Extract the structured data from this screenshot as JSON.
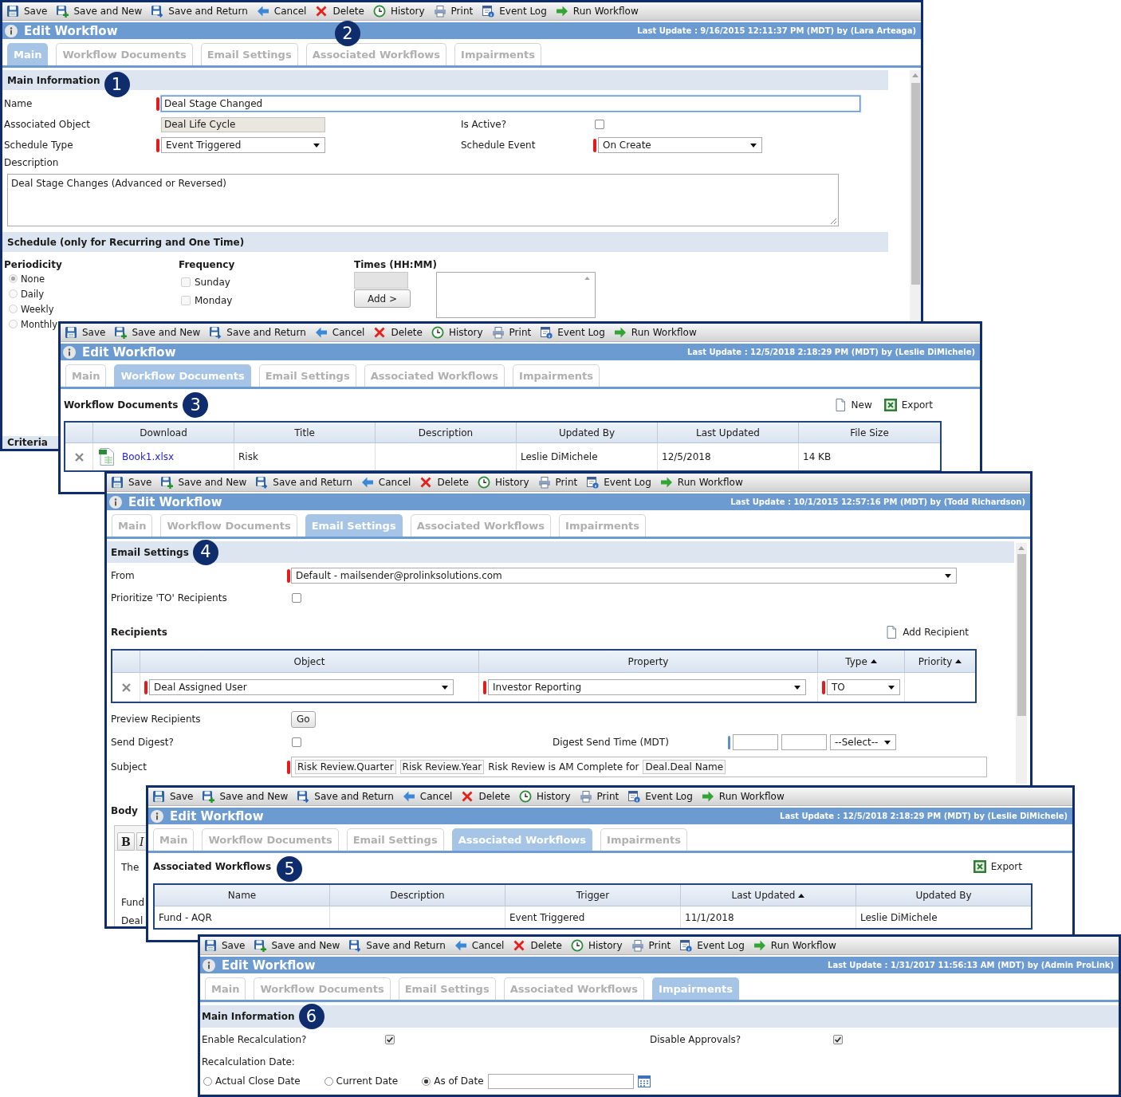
{
  "windows": [
    {
      "kind": "main",
      "toolbar": [
        {
          "kind": "save",
          "label": "Save"
        },
        {
          "kind": "save_new",
          "label": "Save and New"
        },
        {
          "kind": "save_return",
          "label": "Save and Return"
        },
        {
          "kind": "cancel",
          "label": "Cancel"
        },
        {
          "kind": "delete",
          "label": "Delete"
        },
        {
          "kind": "history",
          "label": "History"
        },
        {
          "kind": "print",
          "label": "Print"
        },
        {
          "kind": "event_log",
          "label": "Event Log"
        },
        {
          "kind": "run",
          "label": "Run Workflow"
        }
      ],
      "title": "Edit Workflow",
      "title_callout": "2",
      "last_update": "Last Update : 9/16/2015 12:11:37 PM (MDT) by (Lara Arteaga)",
      "tabs": [
        {
          "label": "Main",
          "selected": true
        },
        {
          "label": "Workflow Documents",
          "selected": false
        },
        {
          "label": "Email Settings",
          "selected": false
        },
        {
          "label": "Associated Workflows",
          "selected": false
        },
        {
          "label": "Impairments",
          "selected": false
        }
      ],
      "main_information": {
        "heading": "Main Information",
        "callout": "1",
        "name": {
          "label": "Name",
          "value": "Deal Stage Changed",
          "required": true,
          "focused": true
        },
        "associated_object": {
          "label": "Associated Object",
          "value": "Deal Life Cycle",
          "readonly": true
        },
        "is_active": {
          "label": "Is Active?",
          "checked": false
        },
        "schedule_type": {
          "label": "Schedule Type",
          "value": "Event Triggered",
          "required": true
        },
        "schedule_event": {
          "label": "Schedule Event",
          "value": "On Create",
          "required": true
        },
        "description": {
          "label": "Description",
          "value": "Deal Stage Changes (Advanced or Reversed)"
        }
      },
      "schedule": {
        "heading": "Schedule (only for Recurring and One Time)",
        "periodicity": {
          "label": "Periodicity",
          "options": [
            {
              "label": "None",
              "selected": true,
              "disabled": true
            },
            {
              "label": "Daily",
              "selected": false,
              "disabled": true
            },
            {
              "label": "Weekly",
              "selected": false,
              "disabled": true
            },
            {
              "label": "Monthly",
              "selected": false,
              "disabled": true
            }
          ]
        },
        "frequency": {
          "label": "Frequency",
          "options": [
            {
              "label": "Sunday",
              "checked": false,
              "disabled": true
            },
            {
              "label": "Monday",
              "checked": false,
              "disabled": true
            }
          ]
        },
        "times": {
          "label": "Times (HH:MM)",
          "disabled": true,
          "add_button": "Add >"
        }
      },
      "criteria": {
        "heading": "Criteria"
      }
    },
    {
      "kind": "documents",
      "toolbar": [
        {
          "kind": "save",
          "label": "Save"
        },
        {
          "kind": "save_new",
          "label": "Save and New"
        },
        {
          "kind": "save_return",
          "label": "Save and Return"
        },
        {
          "kind": "cancel",
          "label": "Cancel"
        },
        {
          "kind": "delete",
          "label": "Delete"
        },
        {
          "kind": "history",
          "label": "History"
        },
        {
          "kind": "print",
          "label": "Print"
        },
        {
          "kind": "event_log",
          "label": "Event Log"
        },
        {
          "kind": "run",
          "label": "Run Workflow"
        }
      ],
      "title": "Edit Workflow",
      "last_update": "Last Update : 12/5/2018 2:18:29 PM (MDT) by (Leslie DiMichele)",
      "tabs": [
        {
          "label": "Main",
          "selected": false
        },
        {
          "label": "Workflow Documents",
          "selected": true
        },
        {
          "label": "Email Settings",
          "selected": false
        },
        {
          "label": "Associated Workflows",
          "selected": false
        },
        {
          "label": "Impairments",
          "selected": false
        }
      ],
      "documents": {
        "heading": "Workflow Documents",
        "callout": "3",
        "actions": [
          {
            "kind": "new",
            "label": "New"
          },
          {
            "kind": "export",
            "label": "Export"
          }
        ],
        "columns": [
          {
            "label": "Download"
          },
          {
            "label": "Title"
          },
          {
            "label": "Description"
          },
          {
            "label": "Updated By"
          },
          {
            "label": "Last Updated"
          },
          {
            "label": "File Size"
          }
        ],
        "rows": [
          {
            "download": "Book1.xlsx",
            "title": "Risk",
            "updated_by": "Leslie DiMichele",
            "last_updated": "12/5/2018",
            "file_size": "14 KB"
          }
        ]
      }
    },
    {
      "kind": "email",
      "toolbar": [
        {
          "kind": "save",
          "label": "Save"
        },
        {
          "kind": "save_new",
          "label": "Save and New"
        },
        {
          "kind": "save_return",
          "label": "Save and Return"
        },
        {
          "kind": "cancel",
          "label": "Cancel"
        },
        {
          "kind": "delete",
          "label": "Delete"
        },
        {
          "kind": "history",
          "label": "History"
        },
        {
          "kind": "print",
          "label": "Print"
        },
        {
          "kind": "event_log",
          "label": "Event Log"
        },
        {
          "kind": "run",
          "label": "Run Workflow"
        }
      ],
      "title": "Edit Workflow",
      "last_update": "Last Update : 10/1/2015 12:57:16 PM (MDT) by (Todd Richardson)",
      "tabs": [
        {
          "label": "Main",
          "selected": false
        },
        {
          "label": "Workflow Documents",
          "selected": false
        },
        {
          "label": "Email Settings",
          "selected": true
        },
        {
          "label": "Associated Workflows",
          "selected": false
        },
        {
          "label": "Impairments",
          "selected": false
        }
      ],
      "email": {
        "heading": "Email Settings",
        "callout": "4",
        "from": {
          "label": "From",
          "value": "Default - mailsender@prolinksolutions.com",
          "required": true
        },
        "prioritize_to": {
          "label": "Prioritize 'TO' Recipients",
          "checked": false
        },
        "recipients": {
          "heading": "Recipients",
          "actions": [
            {
              "kind": "add",
              "label": "Add Recipient"
            }
          ],
          "columns": [
            {
              "label": "Object",
              "sorted": false
            },
            {
              "label": "Property",
              "sorted": false
            },
            {
              "label": "Type",
              "sorted": true
            },
            {
              "label": "Priority",
              "sorted": true
            }
          ],
          "rows": [
            {
              "object": {
                "value": "Deal Assigned User",
                "required": true
              },
              "property": {
                "value": "Investor Reporting",
                "required": true
              },
              "type": {
                "value": "TO",
                "required": true
              }
            }
          ]
        },
        "preview": {
          "label": "Preview Recipients",
          "button": "Go"
        },
        "send_digest": {
          "label": "Send Digest?",
          "checked": false
        },
        "digest_time": {
          "label": "Digest Send Time (MDT)",
          "marked": true,
          "select": "--Select--"
        },
        "subject": {
          "label": "Subject",
          "required": true,
          "parts": [
            {
              "kind": "token",
              "text": "Risk Review.Quarter"
            },
            {
              "kind": "token",
              "text": "Risk Review.Year"
            },
            {
              "kind": "text",
              "text": "Risk Review is AM Complete for"
            },
            {
              "kind": "token",
              "text": "Deal.Deal Name"
            }
          ]
        },
        "body": {
          "heading": "Body",
          "format_buttons": [
            {
              "kind": "bold",
              "label": "B"
            },
            {
              "kind": "italic",
              "label": "I"
            }
          ],
          "lines": [
            "The",
            "Fund",
            "Deal"
          ]
        }
      }
    },
    {
      "kind": "associated",
      "toolbar": [
        {
          "kind": "save",
          "label": "Save"
        },
        {
          "kind": "save_new",
          "label": "Save and New"
        },
        {
          "kind": "save_return",
          "label": "Save and Return"
        },
        {
          "kind": "cancel",
          "label": "Cancel"
        },
        {
          "kind": "delete",
          "label": "Delete"
        },
        {
          "kind": "history",
          "label": "History"
        },
        {
          "kind": "print",
          "label": "Print"
        },
        {
          "kind": "event_log",
          "label": "Event Log"
        },
        {
          "kind": "run",
          "label": "Run Workflow"
        }
      ],
      "title": "Edit Workflow",
      "last_update": "Last Update : 12/5/2018 2:18:29 PM (MDT) by (Leslie DiMichele)",
      "tabs": [
        {
          "label": "Main",
          "selected": false
        },
        {
          "label": "Workflow Documents",
          "selected": false
        },
        {
          "label": "Email Settings",
          "selected": false
        },
        {
          "label": "Associated Workflows",
          "selected": true
        },
        {
          "label": "Impairments",
          "selected": false
        }
      ],
      "associated": {
        "heading": "Associated Workflows",
        "callout": "5",
        "actions": [
          {
            "kind": "export",
            "label": "Export"
          }
        ],
        "columns": [
          {
            "label": "Name",
            "sorted": false
          },
          {
            "label": "Description",
            "sorted": false
          },
          {
            "label": "Trigger",
            "sorted": false
          },
          {
            "label": "Last Updated",
            "sorted": true
          },
          {
            "label": "Updated By",
            "sorted": false
          }
        ],
        "rows": [
          {
            "name": "Fund - AQR",
            "trigger": "Event Triggered",
            "last_updated": "11/1/2018",
            "updated_by": "Leslie DiMichele"
          }
        ]
      }
    },
    {
      "kind": "impairments",
      "toolbar": [
        {
          "kind": "save",
          "label": "Save"
        },
        {
          "kind": "save_new",
          "label": "Save and New"
        },
        {
          "kind": "save_return",
          "label": "Save and Return"
        },
        {
          "kind": "cancel",
          "label": "Cancel"
        },
        {
          "kind": "delete",
          "label": "Delete"
        },
        {
          "kind": "history",
          "label": "History"
        },
        {
          "kind": "print",
          "label": "Print"
        },
        {
          "kind": "event_log",
          "label": "Event Log"
        },
        {
          "kind": "run",
          "label": "Run Workflow"
        }
      ],
      "title": "Edit Workflow",
      "last_update": "Last Update : 1/31/2017 11:56:13 AM (MDT) by (Admin ProLink)",
      "tabs": [
        {
          "label": "Main",
          "selected": false
        },
        {
          "label": "Workflow Documents",
          "selected": false
        },
        {
          "label": "Email Settings",
          "selected": false
        },
        {
          "label": "Associated Workflows",
          "selected": false
        },
        {
          "label": "Impairments",
          "selected": true
        }
      ],
      "impairments": {
        "heading": "Main Information",
        "callout": "6",
        "enable_recalculation": {
          "label": "Enable Recalculation?",
          "checked": true
        },
        "disable_approvals": {
          "label": "Disable Approvals?",
          "checked": true
        },
        "recalculation_date": {
          "label": "Recalculation Date:",
          "options": [
            {
              "label": "Actual Close Date",
              "selected": false
            },
            {
              "label": "Current Date",
              "selected": false
            },
            {
              "label": "As of Date",
              "selected": true
            }
          ]
        }
      }
    }
  ]
}
